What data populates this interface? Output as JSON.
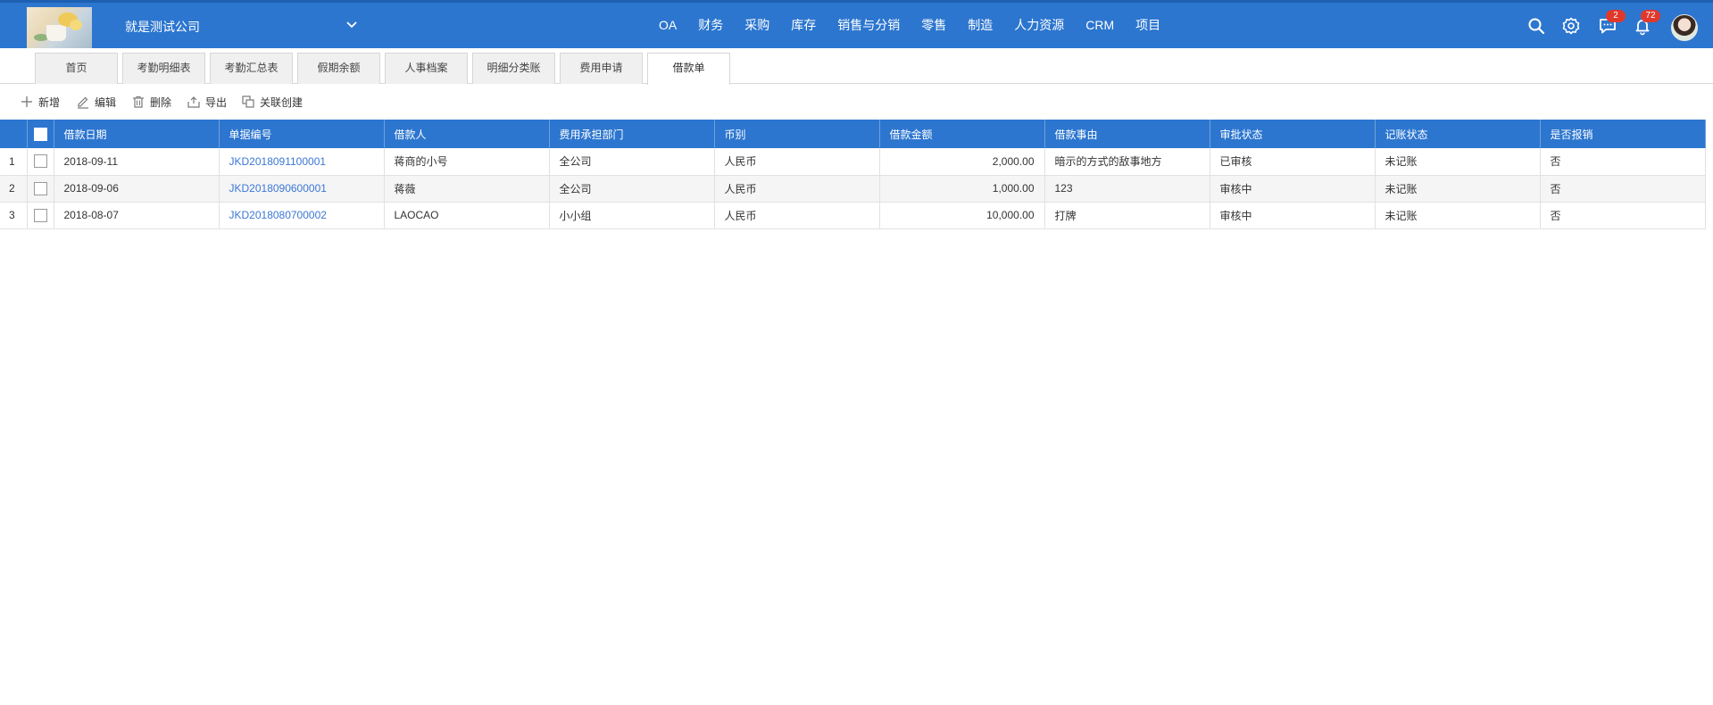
{
  "header": {
    "company_name": "就是测试公司",
    "nav": [
      "OA",
      "财务",
      "采购",
      "库存",
      "销售与分销",
      "零售",
      "制造",
      "人力资源",
      "CRM",
      "项目"
    ],
    "message_badge": "2",
    "notification_badge": "72"
  },
  "tabs": [
    "首页",
    "考勤明细表",
    "考勤汇总表",
    "假期余额",
    "人事档案",
    "明细分类账",
    "费用申请",
    "借款单"
  ],
  "toolbar": {
    "add": "新增",
    "edit": "编辑",
    "delete": "删除",
    "export": "导出",
    "related_create": "关联创建"
  },
  "table": {
    "columns": [
      "借款日期",
      "单据编号",
      "借款人",
      "费用承担部门",
      "币别",
      "借款金额",
      "借款事由",
      "审批状态",
      "记账状态",
      "是否报销"
    ],
    "rows": [
      {
        "index": "1",
        "date": "2018-09-11",
        "doc_no": "JKD2018091100001",
        "borrower": "蒋商的小号",
        "dept": "全公司",
        "currency": "人民币",
        "amount": "2,000.00",
        "reason": "暗示的方式的敌事地方",
        "approval": "已审核",
        "posting": "未记账",
        "reimbursed": "否"
      },
      {
        "index": "2",
        "date": "2018-09-06",
        "doc_no": "JKD2018090600001",
        "borrower": "蒋薇",
        "dept": "全公司",
        "currency": "人民币",
        "amount": "1,000.00",
        "reason": "123",
        "approval": "审核中",
        "posting": "未记账",
        "reimbursed": "否"
      },
      {
        "index": "3",
        "date": "2018-08-07",
        "doc_no": "JKD2018080700002",
        "borrower": "LAOCAO",
        "dept": "小小组",
        "currency": "人民币",
        "amount": "10,000.00",
        "reason": "打牌",
        "approval": "审核中",
        "posting": "未记账",
        "reimbursed": "否"
      }
    ]
  },
  "colors": {
    "header_blue": "#2c76cf",
    "link_blue": "#3b77d6",
    "badge_red": "#e0382b"
  }
}
